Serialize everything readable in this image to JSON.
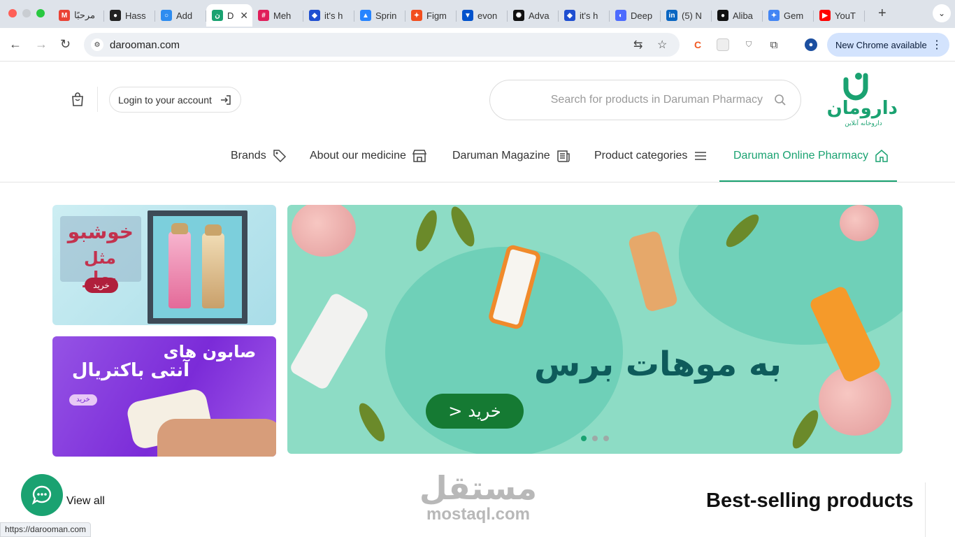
{
  "browser": {
    "tabs": [
      {
        "title": "مرحبًا",
        "icon": "gmail-icon",
        "color": "#ea4335",
        "glyph": "M"
      },
      {
        "title": "Hass",
        "icon": "hass-icon",
        "color": "#222222",
        "glyph": "●"
      },
      {
        "title": "Add",
        "icon": "add-icon",
        "color": "#2d8cf0",
        "glyph": "○"
      },
      {
        "title": "D",
        "icon": "daruman-icon",
        "color": "#1aa271",
        "glyph": "ن",
        "active": true
      },
      {
        "title": "Meh",
        "icon": "slack-icon",
        "color": "#e01e5a",
        "glyph": "#"
      },
      {
        "title": "it's h",
        "icon": "shield-icon",
        "color": "#1f4fd1",
        "glyph": "◆"
      },
      {
        "title": "Sprin",
        "icon": "jira-icon",
        "color": "#2684ff",
        "glyph": "▲"
      },
      {
        "title": "Figm",
        "icon": "figma-icon",
        "color": "#f24e1e",
        "glyph": "✦"
      },
      {
        "title": "evon",
        "icon": "bitbucket-icon",
        "color": "#0052cc",
        "glyph": "▼"
      },
      {
        "title": "Adva",
        "icon": "openai-icon",
        "color": "#111111",
        "glyph": "✺"
      },
      {
        "title": "it's h",
        "icon": "shield-icon",
        "color": "#1f4fd1",
        "glyph": "◆"
      },
      {
        "title": "Deep",
        "icon": "deepseek-icon",
        "color": "#4d6bfe",
        "glyph": "◐"
      },
      {
        "title": "(5) N",
        "icon": "linkedin-icon",
        "color": "#0a66c2",
        "glyph": "in"
      },
      {
        "title": "Aliba",
        "icon": "github-icon",
        "color": "#111111",
        "glyph": "●"
      },
      {
        "title": "Gem",
        "icon": "gemini-icon",
        "color": "#4285f4",
        "glyph": "✦"
      },
      {
        "title": "YouT",
        "icon": "youtube-icon",
        "color": "#ff0000",
        "glyph": "▶"
      }
    ],
    "url": "darooman.com",
    "update_label": "New Chrome available",
    "status_url": "https://darooman.com"
  },
  "header": {
    "login_label": "Login to your account",
    "search_placeholder": "Search for products in Daruman Pharmacy",
    "logo_text": "دارومان",
    "logo_tagline": "داروخانه آنلاین"
  },
  "menu": [
    {
      "label": "Brands",
      "icon": "tag-icon"
    },
    {
      "label": "About our medicine",
      "icon": "store-icon"
    },
    {
      "label": "Daruman Magazine",
      "icon": "newspaper-icon"
    },
    {
      "label": "Product categories",
      "icon": "menu-icon"
    },
    {
      "label": "Daruman Online Pharmacy",
      "icon": "home-icon",
      "active": true
    }
  ],
  "banners": {
    "perfume": {
      "line1": "خوشبو",
      "line2": "مثل بهار",
      "buy": "خرید"
    },
    "soap": {
      "line1": "صابون های",
      "line2": "آنتی باکتریال",
      "buy": "خرید"
    },
    "hero": {
      "headline": "به موهات برس",
      "buy": "خرید",
      "slide_count": 3,
      "active_slide": 1
    }
  },
  "section": {
    "title": "Best-selling products",
    "view_all": "View all"
  },
  "watermark": {
    "ar": "مستقل",
    "en": "mostaql.com"
  },
  "colors": {
    "brand_green": "#1aa271",
    "hero_bg": "#8ddcc5",
    "soap_purple": "#7b2bd8"
  }
}
